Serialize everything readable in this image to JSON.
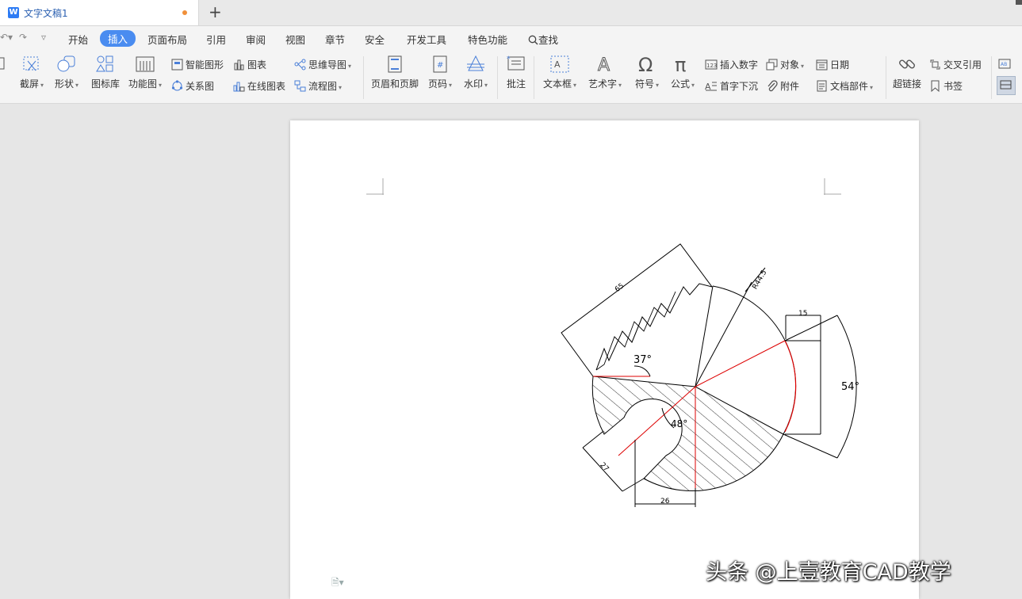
{
  "tabs": {
    "document_title": "文字文稿1",
    "new_tab": "+"
  },
  "menu": {
    "items": [
      "开始",
      "插入",
      "页面布局",
      "引用",
      "审阅",
      "视图",
      "章节",
      "安全",
      "开发工具",
      "特色功能"
    ],
    "active": "插入",
    "search": "查找"
  },
  "ribbon": {
    "screenshot": "截屏",
    "shape": "形状",
    "icon_lib": "图标库",
    "func_chart": "功能图",
    "smart_art": "智能图形",
    "chart": "图表",
    "mind_map": "思维导图",
    "relation": "关系图",
    "online_chart": "在线图表",
    "flowchart": "流程图",
    "header_footer": "页眉和页脚",
    "page_num": "页码",
    "watermark": "水印",
    "comment": "批注",
    "text_box": "文本框",
    "word_art": "艺术字",
    "symbol": "符号",
    "formula": "公式",
    "insert_number": "插入数字",
    "object": "对象",
    "date": "日期",
    "drop_cap": "首字下沉",
    "attachment": "附件",
    "doc_parts": "文档部件",
    "hyperlink": "超链接",
    "cross_ref": "交叉引用",
    "bookmark": "书签"
  },
  "drawing": {
    "dim_65": "65",
    "dim_r": "R44.5",
    "dim_15": "15",
    "dim_54": "54°",
    "dim_37": "37°",
    "dim_48": "48°",
    "dim_27": "27",
    "dim_26": "26"
  },
  "watermark_text": "头条 @上壹教育CAD教学"
}
